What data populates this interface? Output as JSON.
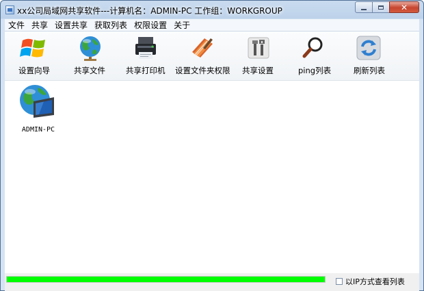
{
  "window": {
    "title": "xx公司局域网共享软件---计算机名：ADMIN-PC  工作组：WORKGROUP"
  },
  "menu": {
    "items": [
      "文件",
      "共享",
      "设置共享",
      "获取列表",
      "权限设置",
      "关于"
    ]
  },
  "toolbar": {
    "buttons": [
      {
        "label": "设置向导",
        "icon": "windows-flag-icon"
      },
      {
        "label": "共享文件",
        "icon": "globe-icon"
      },
      {
        "label": "共享打印机",
        "icon": "printer-icon"
      },
      {
        "label": "设置文件夹权限",
        "icon": "notebook-pencil-icon"
      },
      {
        "label": "共享设置",
        "icon": "tools-icon"
      },
      {
        "label": "ping列表",
        "icon": "magnifier-icon"
      },
      {
        "label": "刷新列表",
        "icon": "refresh-icon"
      }
    ]
  },
  "hosts": [
    {
      "name": "ADMIN-PC",
      "icon": "network-computer-icon"
    }
  ],
  "status": {
    "progress": 1.0,
    "progress_color": "#00ff00",
    "checkbox_label": "以IP方式查看列表",
    "checkbox_checked": false
  }
}
